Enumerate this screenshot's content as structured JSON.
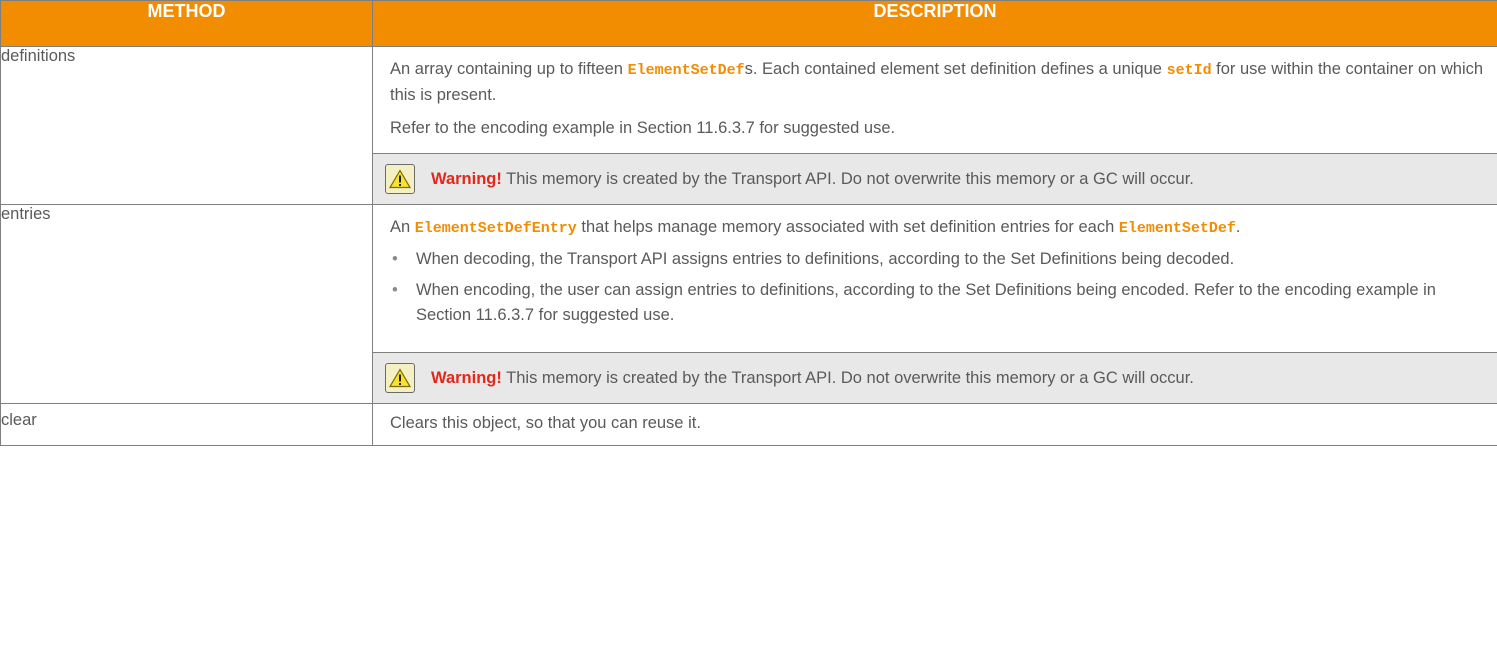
{
  "table": {
    "headers": {
      "method": "METHOD",
      "description": "DESCRIPTION"
    },
    "rows": {
      "definitions": {
        "method": "definitions",
        "desc_pre": "An array containing up to fifteen ",
        "code1": "ElementSetDef",
        "desc_mid": "s. Each contained element set definition defines a unique ",
        "code2": "setId",
        "desc_post": " for use within the container on which this is present.",
        "note": "Refer to the encoding example in Section 11.6.3.7 for suggested use.",
        "warning_label": "Warning!",
        "warning_text": " This memory is created by the Transport API. Do not overwrite this memory or a GC will occur."
      },
      "entries": {
        "method": "entries",
        "desc_pre": "An ",
        "code1": "ElementSetDefEntry",
        "desc_mid": " that helps manage memory associated with set definition entries for each ",
        "code2": "ElementSetDef",
        "desc_post": ".",
        "bullets": [
          "When decoding, the Transport API assigns entries to definitions, according to the Set Definitions being decoded.",
          "When encoding, the user can assign entries to definitions, according to the Set Definitions being encoded. Refer to the encoding example in Section 11.6.3.7 for suggested use."
        ],
        "warning_label": "Warning!",
        "warning_text": " This memory is created by the Transport API. Do not overwrite this memory or a GC will occur."
      },
      "clear": {
        "method": "clear",
        "desc": "Clears this object, so that you can reuse it."
      }
    },
    "colors": {
      "header_bg": "#f28c00",
      "code_color": "#f28c00",
      "warning_label": "#e3271b",
      "note_bg": "#e8e8e8"
    },
    "icons": {
      "warning": "warning-triangle-icon"
    }
  }
}
